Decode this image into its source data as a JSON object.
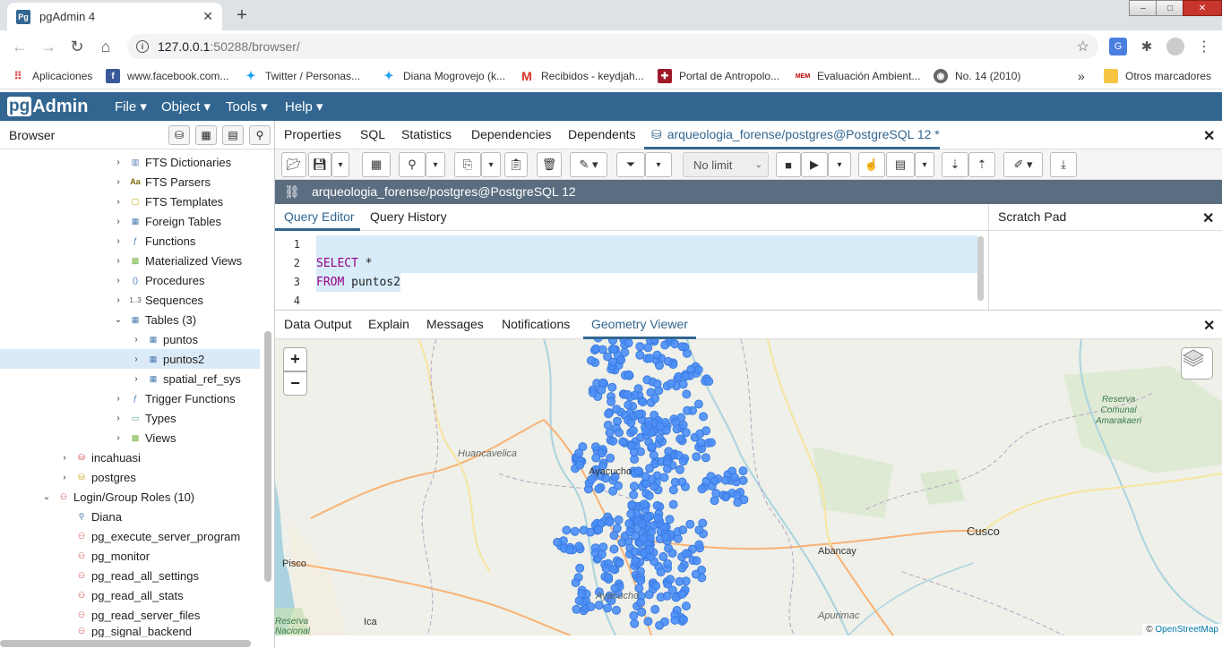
{
  "browser_chrome": {
    "tab_title": "pgAdmin 4",
    "tab_favicon": "Pg",
    "new_tab": "+",
    "url_host": "127.0.0.1",
    "url_rest": ":50288/browser/",
    "window_buttons": {
      "minimize": "–",
      "maximize": "□",
      "close": "✕"
    }
  },
  "bookmarks": [
    {
      "label": "Aplicaciones",
      "icon": "apps-grid-icon"
    },
    {
      "label": "www.facebook.com...",
      "icon": "facebook-icon"
    },
    {
      "label": "Twitter / Personas...",
      "icon": "twitter-icon"
    },
    {
      "label": "Diana Mogrovejo (k...",
      "icon": "twitter-icon"
    },
    {
      "label": "Recibidos - keydjah...",
      "icon": "gmail-icon"
    },
    {
      "label": "Portal de Antropolo...",
      "icon": "cross-icon"
    },
    {
      "label": "Evaluación Ambient...",
      "icon": "mem-icon"
    },
    {
      "label": "No. 14 (2010)",
      "icon": "globe-icon"
    },
    {
      "label": "»",
      "icon": ""
    },
    {
      "label": "Otros marcadores",
      "icon": "folder-icon"
    }
  ],
  "pgadmin": {
    "logo_pg": "pg",
    "logo_rest": "Admin",
    "menus": [
      "File ▾",
      "Object ▾",
      "Tools ▾",
      "Help ▾"
    ]
  },
  "browser_panel": {
    "title": "Browser",
    "tree": [
      {
        "label": "FTS Dictionaries",
        "icon": "fts-dictionary-icon",
        "expanded": false
      },
      {
        "label": "FTS Parsers",
        "icon": "fts-parser-icon",
        "expanded": false
      },
      {
        "label": "FTS Templates",
        "icon": "fts-template-icon",
        "expanded": false
      },
      {
        "label": "Foreign Tables",
        "icon": "foreign-table-icon",
        "expanded": false
      },
      {
        "label": "Functions",
        "icon": "function-icon",
        "expanded": false
      },
      {
        "label": "Materialized Views",
        "icon": "materialized-view-icon",
        "expanded": false
      },
      {
        "label": "Procedures",
        "icon": "procedure-icon",
        "expanded": false
      },
      {
        "label": "Sequences",
        "icon": "sequence-icon",
        "expanded": false
      },
      {
        "label": "Tables (3)",
        "icon": "tables-icon",
        "expanded": true
      },
      {
        "label": "puntos",
        "icon": "table-icon",
        "expanded": false
      },
      {
        "label": "puntos2",
        "icon": "table-icon",
        "expanded": false,
        "selected": true
      },
      {
        "label": "spatial_ref_sys",
        "icon": "table-icon",
        "expanded": false
      },
      {
        "label": "Trigger Functions",
        "icon": "trigger-function-icon",
        "expanded": false
      },
      {
        "label": "Types",
        "icon": "type-icon",
        "expanded": false
      },
      {
        "label": "Views",
        "icon": "view-icon",
        "expanded": false
      },
      {
        "label": "incahuasi",
        "icon": "database-icon",
        "expanded": false
      },
      {
        "label": "postgres",
        "icon": "database-icon",
        "expanded": false
      },
      {
        "label": "Login/Group Roles (10)",
        "icon": "roles-icon",
        "expanded": true
      },
      {
        "label": "Diana",
        "icon": "user-icon"
      },
      {
        "label": "pg_execute_server_program",
        "icon": "group-role-icon"
      },
      {
        "label": "pg_monitor",
        "icon": "group-role-icon"
      },
      {
        "label": "pg_read_all_settings",
        "icon": "group-role-icon"
      },
      {
        "label": "pg_read_all_stats",
        "icon": "group-role-icon"
      },
      {
        "label": "pg_read_server_files",
        "icon": "group-role-icon"
      },
      {
        "label": "pg_signal_backend",
        "icon": "group-role-icon"
      }
    ]
  },
  "main_tabs": [
    "Properties",
    "SQL",
    "Statistics",
    "Dependencies",
    "Dependents"
  ],
  "query_tab_label": "arqueologia_forense/postgres@PostgreSQL 12 *",
  "toolbar": {
    "limit": "No limit"
  },
  "connection": "arqueologia_forense/postgres@PostgreSQL 12",
  "editor": {
    "tabs": [
      "Query Editor",
      "Query History"
    ],
    "line_numbers": [
      "1",
      "2",
      "3",
      "4"
    ],
    "kw_select": "SELECT",
    "select_rest": " *",
    "kw_from": "FROM",
    "from_rest": " puntos2"
  },
  "scratch_pad": {
    "title": "Scratch Pad"
  },
  "output_tabs": [
    "Data Output",
    "Explain",
    "Messages",
    "Notifications",
    "Geometry Viewer"
  ],
  "map": {
    "zoom_in": "+",
    "zoom_out": "−",
    "labels": {
      "huancavelica": "Huancavelica",
      "ayacucho_a": "Ayacucho",
      "ayacucho_b": "Ayacucho",
      "abancay": "Abancay",
      "cusco": "Cusco",
      "pisco": "Pisco",
      "ica": "Ica",
      "apurimac": "Apurimac",
      "reserva_1": "Reserva",
      "reserva_2": "Comunal",
      "reserva_3": "Amarakaeri",
      "reserva_nac_1": "Reserva",
      "reserva_nac_2": "Nacional"
    },
    "attribution_prefix": "© ",
    "attribution_link": "OpenStreetMap",
    "point_color": "#4b8ef7"
  }
}
